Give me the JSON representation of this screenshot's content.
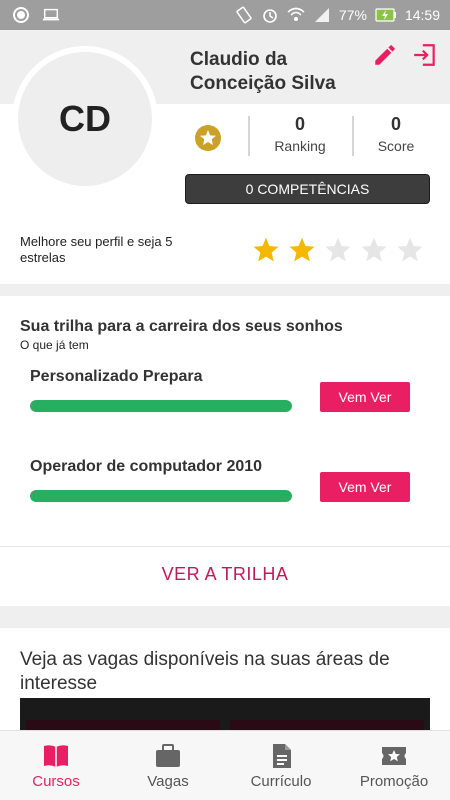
{
  "statusbar": {
    "battery_percent": "77%",
    "time": "14:59"
  },
  "profile": {
    "initials": "CD",
    "name": "Claudio da Conceição Silva",
    "ranking_value": "0",
    "ranking_label": "Ranking",
    "score_value": "0",
    "score_label": "Score",
    "competencias_label": "0 COMPETÊNCIAS",
    "improve_text": "Melhore seu perfil e seja 5 estrelas",
    "stars_filled": 2,
    "stars_total": 5
  },
  "trilha": {
    "title": "Sua trilha para a carreira dos seus sonhos",
    "subtitle": "O que já tem",
    "courses": [
      {
        "name": "Personalizado Prepara",
        "progress": 1.0,
        "button": "Vem Ver"
      },
      {
        "name": "Operador de computador 2010",
        "progress": 1.0,
        "button": "Vem Ver"
      }
    ],
    "ver_trilha_label": "VER A TRILHA"
  },
  "vagas": {
    "title": "Veja as vagas disponíveis na suas áreas de interesse"
  },
  "bottomnav": {
    "items": [
      {
        "label": "Cursos",
        "icon": "book-icon",
        "active": true
      },
      {
        "label": "Vagas",
        "icon": "briefcase-icon",
        "active": false
      },
      {
        "label": "Currículo",
        "icon": "document-icon",
        "active": false
      },
      {
        "label": "Promoção",
        "icon": "ticket-star-icon",
        "active": false
      }
    ]
  },
  "colors": {
    "accent": "#e91e63",
    "progress": "#27ae60",
    "star_filled": "#f5b800",
    "star_empty": "#e6e6e6",
    "medal": "#c9a227"
  }
}
